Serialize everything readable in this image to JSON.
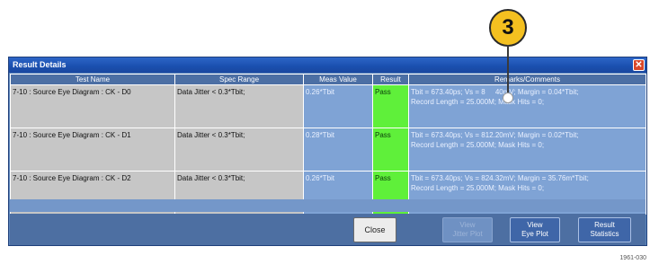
{
  "callout": {
    "number": "3"
  },
  "window": {
    "title": "Result Details"
  },
  "table": {
    "headers": [
      "Test Name",
      "Spec Range",
      "Meas Value",
      "Result",
      "Remarks/Comments"
    ],
    "rows": [
      {
        "name": "7-10 : Source Eye Diagram : CK - D0",
        "spec": "Data Jitter < 0.3*Tbit;",
        "meas": "0.26*Tbit",
        "result": "Pass",
        "remark1": "Tbit = 673.40ps; Vs = 8     40mV; Margin = 0.04*Tbit;",
        "remark2": "Record Length = 25.000M; Mask Hits =   0;"
      },
      {
        "name": "7-10 : Source Eye Diagram : CK - D1",
        "spec": "Data Jitter < 0.3*Tbit;",
        "meas": "0.28*Tbit",
        "result": "Pass",
        "remark1": "Tbit = 673.40ps; Vs = 812.20mV; Margin = 0.02*Tbit;",
        "remark2": "Record Length = 25.000M; Mask Hits =   0;"
      },
      {
        "name": "7-10 : Source Eye Diagram : CK - D2",
        "spec": "Data Jitter < 0.3*Tbit;",
        "meas": "0.26*Tbit",
        "result": "Pass",
        "remark1": "Tbit = 673.40ps; Vs = 824.32mV; Margin = 35.76m*Tbit;",
        "remark2": "Record Length = 25.000M; Mask Hits =   0;"
      }
    ]
  },
  "buttons": {
    "close": "Close",
    "jitter_l1": "View",
    "jitter_l2": "Jitter Plot",
    "eye_l1": "View",
    "eye_l2": "Eye Plot",
    "stats_l1": "Result",
    "stats_l2": "Statistics"
  },
  "figure_id": "1961-030"
}
